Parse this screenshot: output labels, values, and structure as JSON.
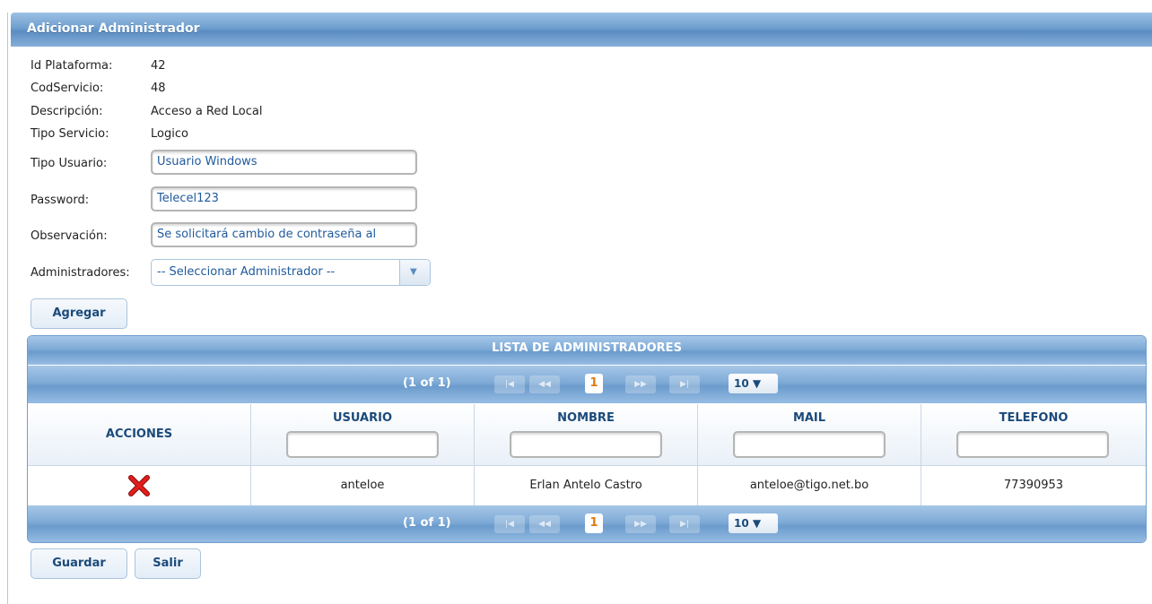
{
  "dialog": {
    "title": "Adicionar Administrador"
  },
  "info": [
    {
      "label": "Id Plataforma:",
      "value": "42"
    },
    {
      "label": "CodServicio:",
      "value": "48"
    },
    {
      "label": "Descripción:",
      "value": "Acceso a Red Local"
    },
    {
      "label": "Tipo Servicio:",
      "value": "Logico"
    }
  ],
  "form": {
    "tipo_usuario_label": "Tipo Usuario:",
    "tipo_usuario_value": "Usuario Windows",
    "password_label": "Password:",
    "password_value": "Telecel123",
    "observacion_label": "Observación:",
    "observacion_value": "Se solicitará cambio de contraseña al",
    "administradores_label": "Administradores:",
    "administradores_selected": "-- Seleccionar Administrador --"
  },
  "buttons": {
    "agregar": "Agregar",
    "guardar": "Guardar",
    "salir": "Salir"
  },
  "table": {
    "title": "LISTA DE ADMINISTRADORES",
    "paginator": {
      "page_info": "(1 of 1)",
      "first_icon": "first-page-icon",
      "prev_icon": "prev-page-icon",
      "current_page": "1",
      "next_icon": "next-page-icon",
      "last_icon": "last-page-icon",
      "rows_per_page": "10 ▼"
    },
    "columns": [
      "ACCIONES",
      "USUARIO",
      "NOMBRE",
      "MAIL",
      "TELEFONO"
    ],
    "rows": [
      {
        "action_icon": "delete-x-icon",
        "usuario": "anteloe",
        "nombre": "Erlan Antelo Castro",
        "mail": "anteloe@tigo.net.bo",
        "telefono": "77390953"
      }
    ]
  },
  "colors": {
    "header_blue": "#6f9fcf",
    "text_blue": "#1b4a7a",
    "delete_red": "#d81414",
    "page_orange": "#e07a10"
  }
}
